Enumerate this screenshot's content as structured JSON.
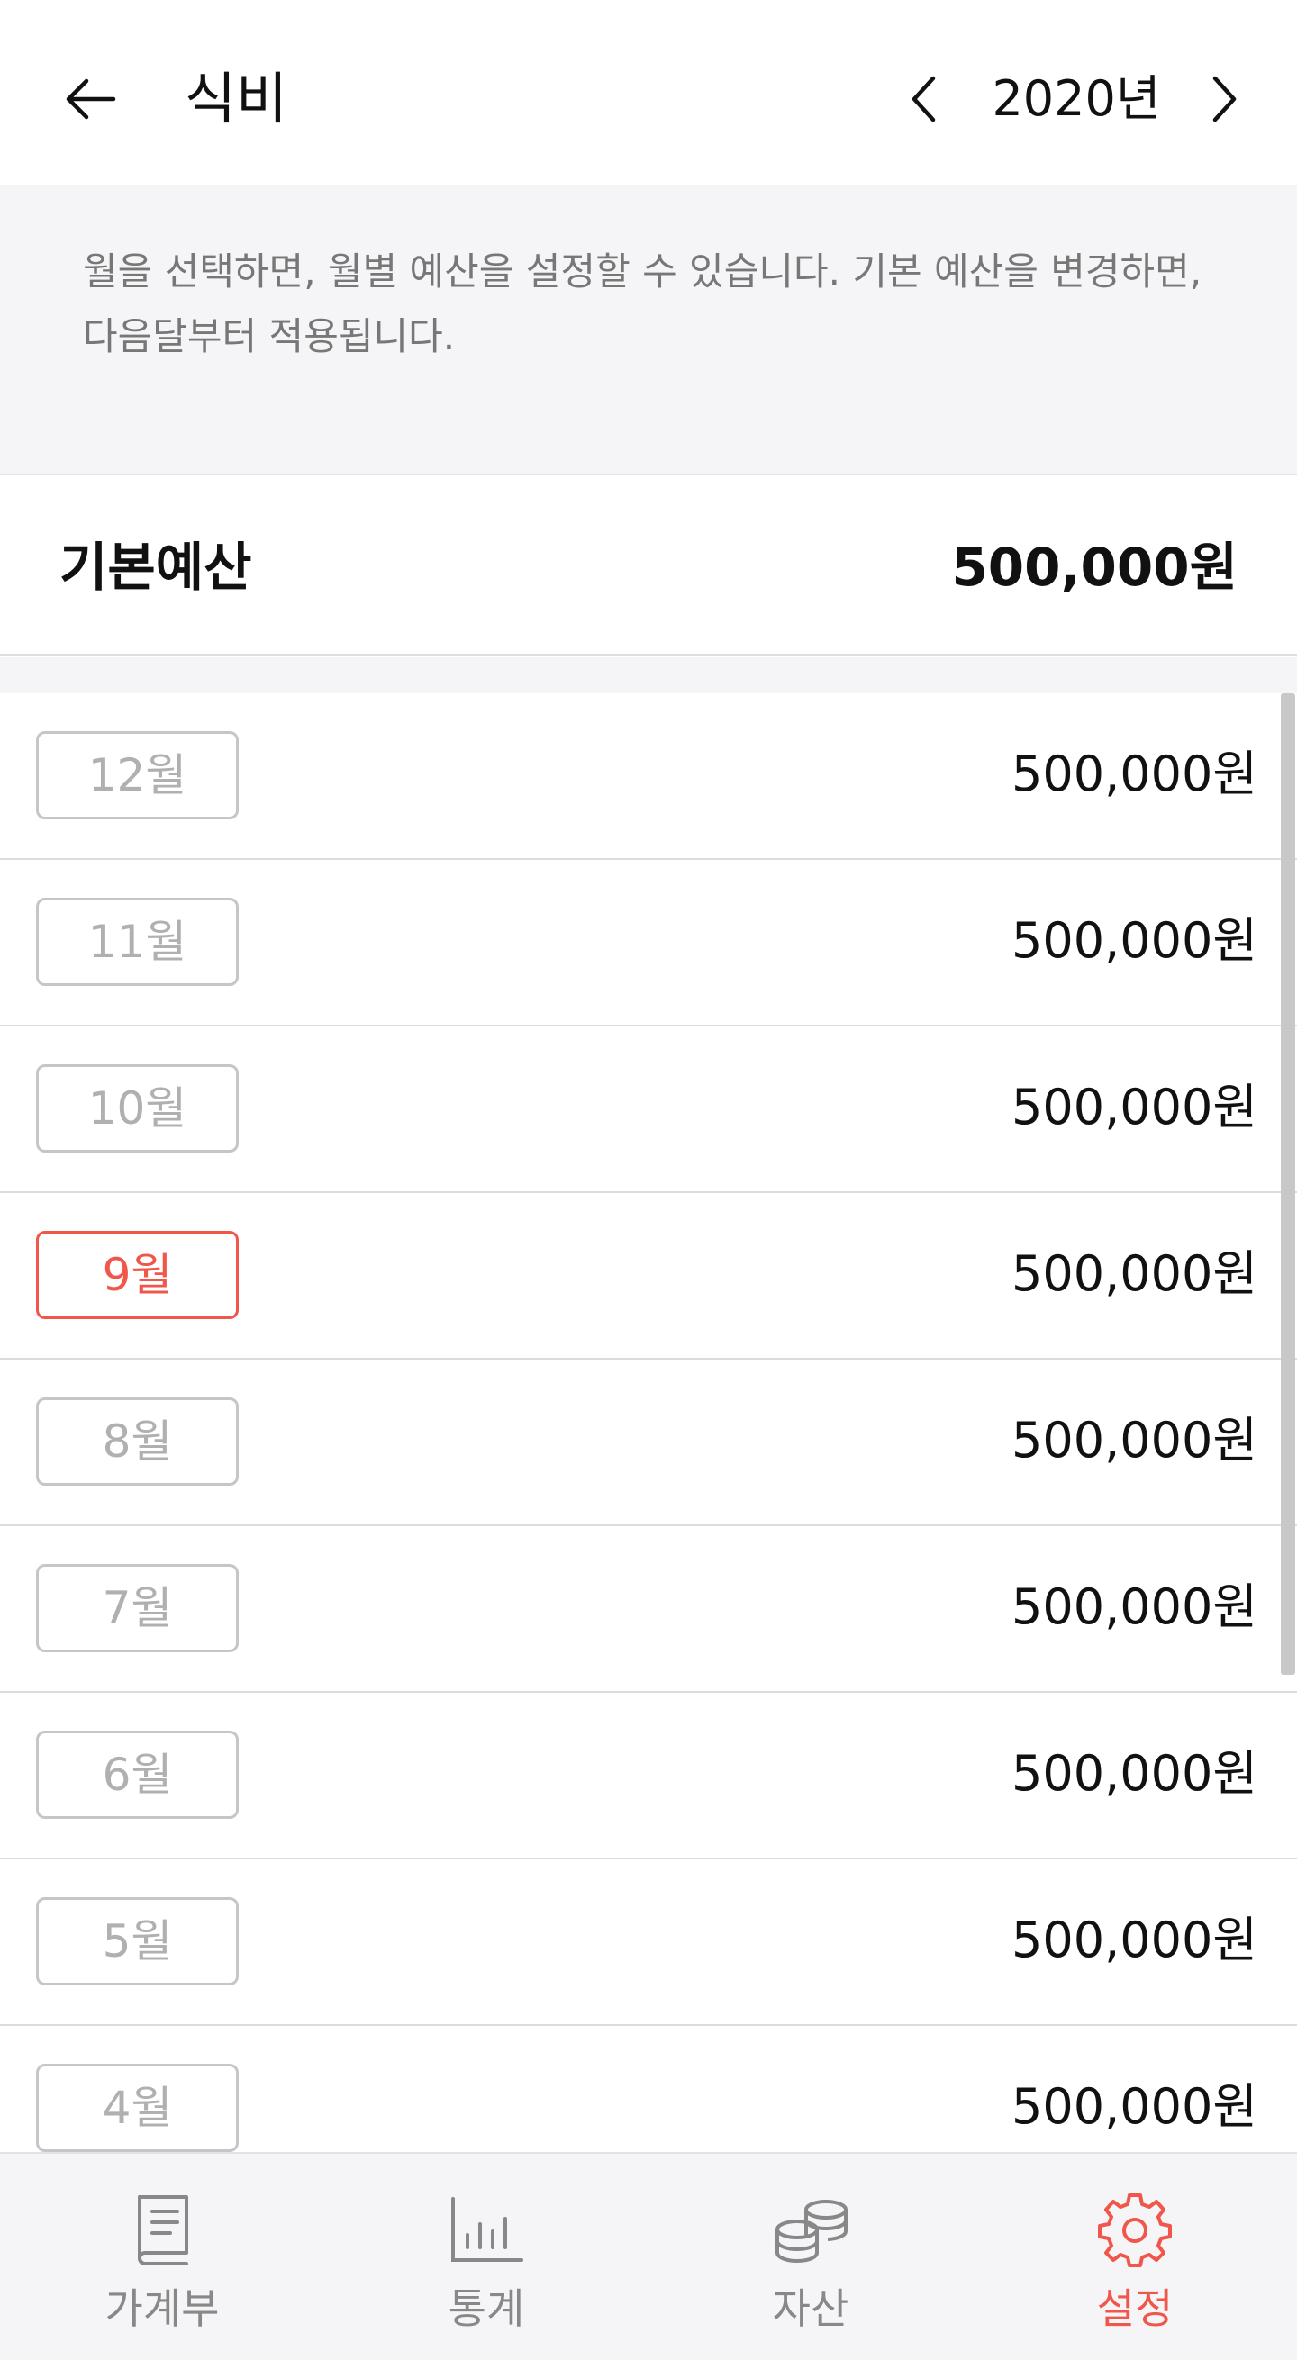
{
  "header": {
    "title": "식비",
    "year": "2020년",
    "back_icon": "arrow-left-icon",
    "prev_icon": "chevron-left-icon",
    "next_icon": "chevron-right-icon"
  },
  "notice": {
    "text": "월을 선택하면, 월별 예산을 설정할 수 있습니다. 기본 예산을 변경하면, 다음달부터 적용됩니다."
  },
  "base_budget": {
    "label": "기본예산",
    "value": "500,000원"
  },
  "months": [
    {
      "label": "12월",
      "amount": "500,000원",
      "active": false
    },
    {
      "label": "11월",
      "amount": "500,000원",
      "active": false
    },
    {
      "label": "10월",
      "amount": "500,000원",
      "active": false
    },
    {
      "label": "9월",
      "amount": "500,000원",
      "active": true
    },
    {
      "label": "8월",
      "amount": "500,000원",
      "active": false
    },
    {
      "label": "7월",
      "amount": "500,000원",
      "active": false
    },
    {
      "label": "6월",
      "amount": "500,000원",
      "active": false
    },
    {
      "label": "5월",
      "amount": "500,000원",
      "active": false
    },
    {
      "label": "4월",
      "amount": "500,000원",
      "active": false
    }
  ],
  "tabs": [
    {
      "label": "가계부",
      "icon": "book-icon",
      "active": false
    },
    {
      "label": "통계",
      "icon": "bar-chart-icon",
      "active": false
    },
    {
      "label": "자산",
      "icon": "coins-icon",
      "active": false
    },
    {
      "label": "설정",
      "icon": "gear-icon",
      "active": true
    }
  ],
  "colors": {
    "accent": "#f0574a",
    "inactive": "#888888",
    "chip_border": "#c6c6c6",
    "background_gray": "#f5f5f7"
  }
}
